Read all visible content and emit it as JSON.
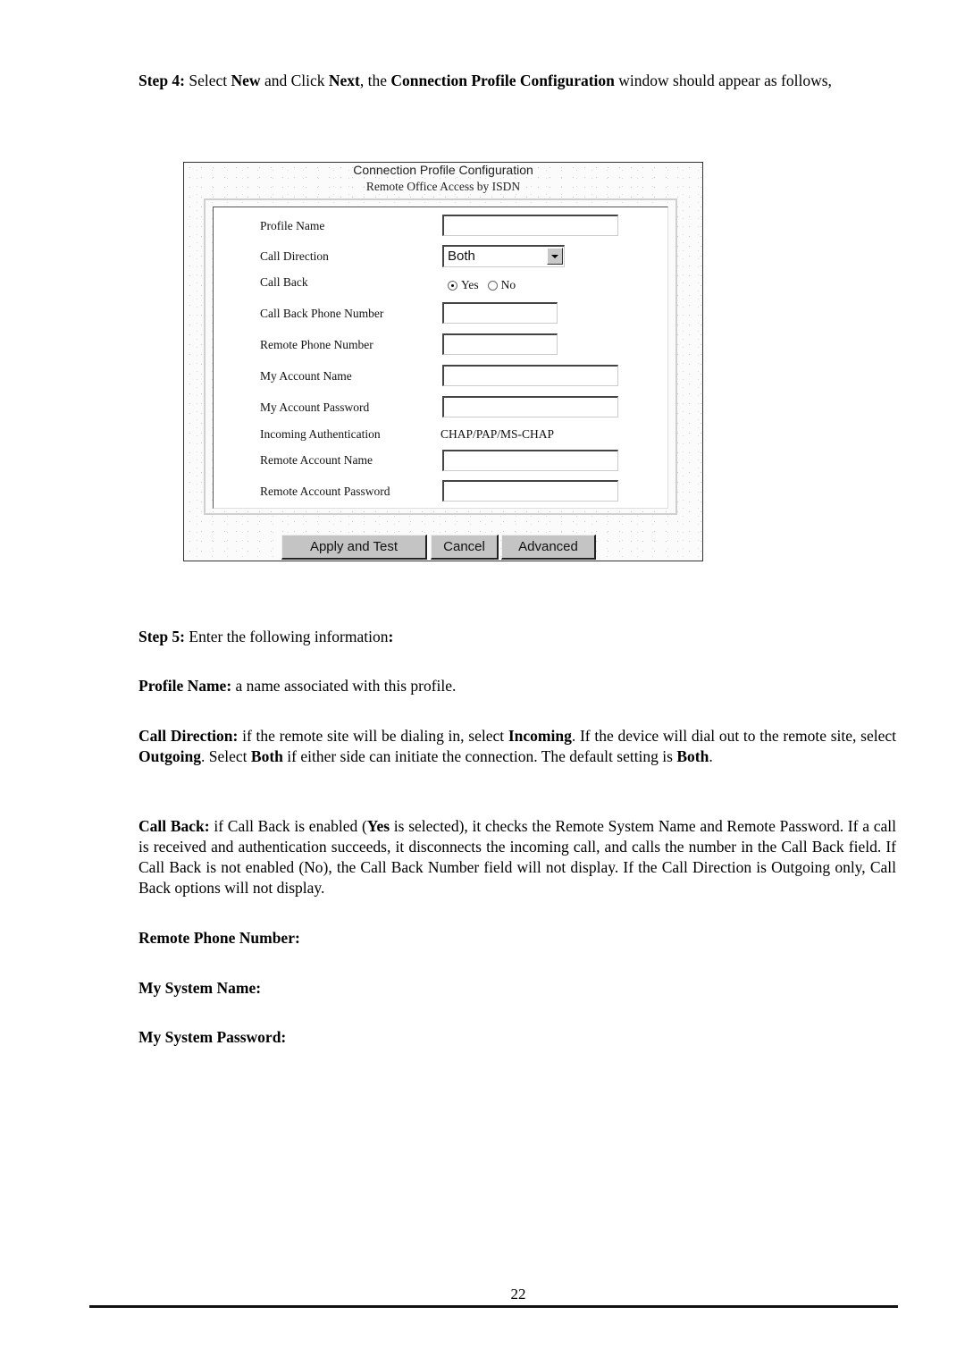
{
  "step4": {
    "prefix": "Step 4:",
    "t1": " Select ",
    "b1": "New",
    "t2": " and Click ",
    "b2": "Next",
    "t3": ", the ",
    "b3": "Connection Profile Configuration",
    "t4": " window should appear as follows,"
  },
  "dialog": {
    "title": "Connection Profile Configuration",
    "subtitle": "Remote Office Access by ISDN",
    "fields": {
      "profile_name": {
        "label": "Profile Name",
        "value": ""
      },
      "call_direction": {
        "label": "Call Direction",
        "selected": "Both"
      },
      "call_back": {
        "label": "Call Back",
        "options": [
          "Yes",
          "No"
        ],
        "selected": "Yes"
      },
      "call_back_phone": {
        "label": "Call Back Phone Number",
        "value": ""
      },
      "remote_phone": {
        "label": "Remote Phone Number",
        "value": ""
      },
      "my_account_name": {
        "label": "My Account Name",
        "value": ""
      },
      "my_account_password": {
        "label": "My Account Password",
        "value": ""
      },
      "incoming_auth": {
        "label": "Incoming Authentication",
        "value": "CHAP/PAP/MS-CHAP"
      },
      "remote_account_name": {
        "label": "Remote Account Name",
        "value": ""
      },
      "remote_account_password": {
        "label": "Remote Account Password",
        "value": ""
      }
    },
    "buttons": {
      "apply": "Apply and Test",
      "cancel": "Cancel",
      "advanced": "Advanced"
    }
  },
  "step5": {
    "prefix": "Step 5:",
    "text": " Enter the following information",
    "colon": ":"
  },
  "profile_name_desc": {
    "term": "Profile Name:",
    "text": " a name associated with this profile."
  },
  "call_direction_desc": {
    "term": "Call Direction:",
    "t1": " if the remote site will be dialing in, select ",
    "b1": "Incoming",
    "t2": ". If the device will dial out to the remote site, select ",
    "b2": "Outgoing",
    "t3": ". Select ",
    "b3": "Both",
    "t4": " if either side can initiate the connection. The default setting is ",
    "b4": "Both",
    "t5": "."
  },
  "call_back_desc": {
    "term": "Call Back:",
    "t1": " if Call Back is enabled (",
    "b1": "Yes",
    "t2": " is selected), it checks the Remote System Name and Remote Password. If a call is received and authentication succeeds, it disconnects the incoming call, and calls the number in the Call Back field. If Call Back is not enabled (No), the Call Back Number field will not display. If the Call Direction is Outgoing only, Call Back options will not display."
  },
  "headings": {
    "remote_phone": "Remote Phone Number:",
    "my_system_name": "My System Name:",
    "my_system_password": "My System Password:"
  },
  "page_number": "22"
}
